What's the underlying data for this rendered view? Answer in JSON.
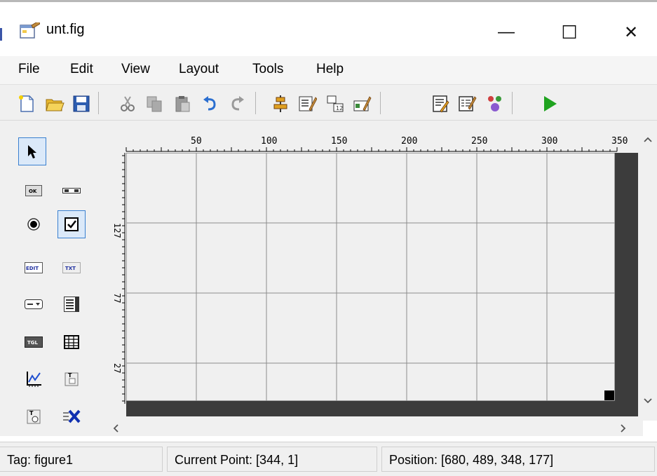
{
  "window": {
    "title": "unt.fig",
    "minimize_glyph": "—",
    "maximize_glyph": "☐",
    "close_glyph": "✕"
  },
  "menu": [
    "File",
    "Edit",
    "View",
    "Layout",
    "Tools",
    "Help"
  ],
  "toolbar": {
    "groups": [
      [
        "new-file-icon",
        "open-folder-icon",
        "save-icon"
      ],
      [
        "cut-icon",
        "copy-icon",
        "paste-icon",
        "undo-icon",
        "redo-icon"
      ],
      [
        "align-objects-icon",
        "menu-editor-icon",
        "tab-order-editor-icon",
        "toolbar-editor-icon"
      ],
      [
        "editor-icon",
        "property-inspector-icon",
        "object-browser-icon"
      ],
      [
        "run-figure-icon"
      ]
    ]
  },
  "palette": {
    "items": [
      {
        "name": "select-tool",
        "icon": "arrow-icon"
      },
      {
        "name": "push-button-tool",
        "icon": "ok-button-icon",
        "text": "OK"
      },
      {
        "name": "slider-tool",
        "icon": "slider-icon"
      },
      {
        "name": "radio-button-tool",
        "icon": "radio-icon"
      },
      {
        "name": "check-box-tool",
        "icon": "checkbox-icon"
      },
      {
        "name": "edit-text-tool",
        "icon": "edit-text-icon",
        "text": "EDIT"
      },
      {
        "name": "static-text-tool",
        "icon": "static-text-icon",
        "text": "TXT"
      },
      {
        "name": "popup-menu-tool",
        "icon": "popup-menu-icon"
      },
      {
        "name": "listbox-tool",
        "icon": "listbox-icon"
      },
      {
        "name": "toggle-button-tool",
        "icon": "toggle-icon",
        "text": "TGL"
      },
      {
        "name": "table-tool",
        "icon": "table-icon"
      },
      {
        "name": "axes-tool",
        "icon": "axes-icon"
      },
      {
        "name": "panel-tool",
        "icon": "panel-icon"
      },
      {
        "name": "button-group-tool",
        "icon": "button-group-icon"
      },
      {
        "name": "activex-control-tool",
        "icon": "activex-icon"
      }
    ]
  },
  "rulers": {
    "x_ticks": [
      "50",
      "100",
      "150",
      "200",
      "250",
      "300",
      "350"
    ],
    "y_ticks": [
      "127",
      "77",
      "27"
    ]
  },
  "status": {
    "tag": "Tag: figure1",
    "current_point": "Current Point:  [344, 1]",
    "position": "Position: [680, 489, 348, 177]"
  },
  "colors": {
    "accent": "#3a80d0",
    "figure_border": "#3c3c3c",
    "grid": "#8c8c8c",
    "run_green": "#1fa31f"
  }
}
